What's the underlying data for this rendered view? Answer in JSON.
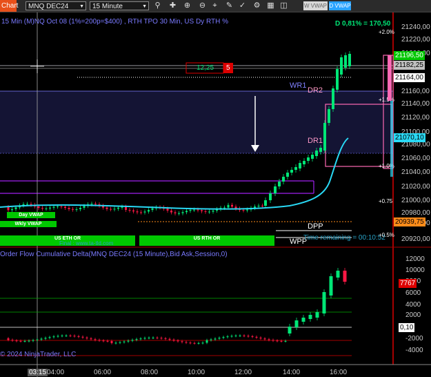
{
  "toolbar": {
    "tab_label": "Chart",
    "instrument": "MNQ DEC24",
    "interval": "15 Minute",
    "icons": [
      "search-icon",
      "crosshair-icon",
      "zoom-in-icon",
      "zoom-out-icon",
      "crosshair-target-icon",
      "text-icon",
      "draw-icon",
      "properties-icon",
      "data-box-icon",
      "strategy-icon"
    ],
    "btn_wvwap": "W VWAP",
    "btn_dvwap": "D VWAP"
  },
  "chart": {
    "description": "15 Min (M)NQ Oct 08 (1%=200p=$400) , RTH TPO 30 Min, US Dy RTH %",
    "daily_change": "D 0,81% = 170,50",
    "copyright": "© 2024 NinjaTrader, LLC",
    "price_ticks": [
      "21240,00",
      "21220,00",
      "21200,00",
      "21160,00",
      "21140,00",
      "21120,00",
      "21100,00",
      "21080,00",
      "21060,00",
      "21040,00",
      "21020,00",
      "21000,00",
      "20980,00",
      "20960,00",
      "20920,00"
    ],
    "pct_labels": {
      "p2": "+2.0%",
      "p1_5": "+1.5%",
      "p1_0": "+1.0%",
      "p0_75": "+0.75",
      "p0_5": "+0.5%"
    },
    "price_boxes": {
      "last": "21196,50",
      "level_1": "21182,25",
      "level_2": "21164,00",
      "vwap": "21070,10",
      "weekly": "20939,75"
    },
    "measure_label": "12,25",
    "measure_count": "5",
    "levels": {
      "wr1": "WR1",
      "dr2": "DR2",
      "dr1": "DR1",
      "dpp": "DPP",
      "wpp": "WPP"
    },
    "time_remaining": "Time remaining = 00:10:52",
    "bars": {
      "day_vwap": "Day VWAP",
      "wkly_vwap": "Wkly VWAP",
      "us_eth_or": "US ETH OR",
      "us_rth_or": "US RTH OR"
    },
    "final_text": "Final : www.ta-tld.com"
  },
  "indicator": {
    "title": "Order Flow Cumulative Delta(MNQ DEC24 (15 Minute),Bid Ask,Session,0)",
    "ticks": [
      "12000",
      "10000",
      "8000",
      "6000",
      "4000",
      "2000",
      "-2000",
      "-4000"
    ],
    "value_box": "7767",
    "zero_box": "0,10"
  },
  "time_axis": {
    "cursor": "03:15",
    "labels": [
      "04:00",
      "06:00",
      "08:00",
      "10:00",
      "12:00",
      "14:00",
      "16:00"
    ]
  },
  "colors": {
    "up": "#00e676",
    "down": "#ff1744",
    "vwap": "#29d9f5",
    "accent": "#e8501a"
  }
}
